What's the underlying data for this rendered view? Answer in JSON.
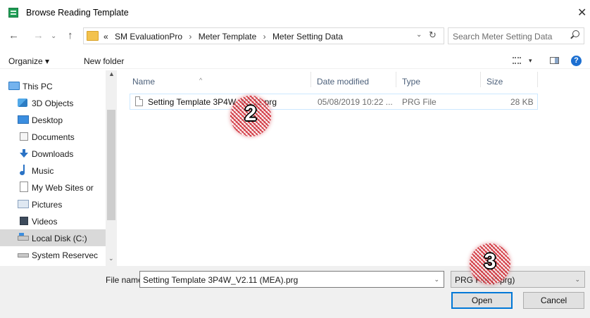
{
  "window": {
    "title": "Browse Reading Template",
    "close_glyph": "✕"
  },
  "nav": {
    "back": "←",
    "forward": "→",
    "recent": "⌄",
    "up": "↑",
    "breadcrumb": [
      "«",
      "SM EvaluationPro",
      "Meter Template",
      "Meter Setting Data"
    ],
    "crumb_sep": "›",
    "address_dropdown": "⌄",
    "refresh": "↻",
    "search_placeholder": "Search Meter Setting Data"
  },
  "commands": {
    "organize": "Organize ▾",
    "new_folder": "New folder",
    "view_dropdown": "▾",
    "help": "?"
  },
  "sidebar": {
    "items": [
      {
        "label": "This PC",
        "icon": "computer-icon"
      },
      {
        "label": "3D Objects",
        "icon": "3d-objects-icon"
      },
      {
        "label": "Desktop",
        "icon": "desktop-icon"
      },
      {
        "label": "Documents",
        "icon": "documents-icon"
      },
      {
        "label": "Downloads",
        "icon": "downloads-icon"
      },
      {
        "label": "Music",
        "icon": "music-icon"
      },
      {
        "label": "My Web Sites or",
        "icon": "web-sites-icon"
      },
      {
        "label": "Pictures",
        "icon": "pictures-icon"
      },
      {
        "label": "Videos",
        "icon": "videos-icon"
      },
      {
        "label": "Local Disk (C:)",
        "icon": "local-disk-icon",
        "selected": true
      },
      {
        "label": "System Reservec",
        "icon": "drive-icon"
      }
    ],
    "scroll_up": "▲",
    "scroll_down": "⌄"
  },
  "file_list": {
    "columns": [
      "Name",
      "Date modified",
      "Type",
      "Size"
    ],
    "sort_indicator": "^",
    "rows": [
      {
        "name": "Setting Template 3P4W_V2.11.prg",
        "date": "05/08/2019 10:22 ...",
        "type": "PRG File",
        "size": "28 KB"
      }
    ]
  },
  "footer": {
    "file_name_label": "File name:",
    "file_name_value": "Setting Template 3P4W_V2.11 (MEA).prg",
    "file_name_dropdown": "⌄",
    "file_type_value": "PRG File (*.prg)",
    "file_type_dropdown": "⌄",
    "open_label": "Open",
    "cancel_label": "Cancel"
  },
  "annotations": {
    "marker_2": "2",
    "marker_3": "3"
  },
  "colors": {
    "accent": "#0078d7",
    "selected_row": "#cce8ff",
    "marker": "#cd232d"
  }
}
